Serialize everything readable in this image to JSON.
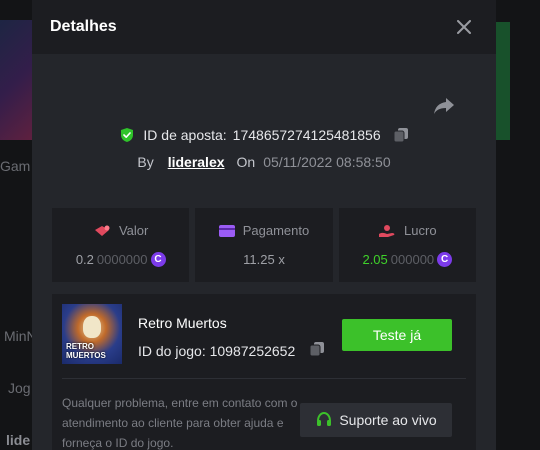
{
  "background": {
    "frag_gam": "Gam",
    "frag_min": "MinN",
    "frag_jog": "Jog",
    "frag_lide": "lide"
  },
  "modal": {
    "title": "Detalhes",
    "bet_id_label": "ID de aposta:",
    "bet_id_value": "1748657274125481856",
    "by_label": "By",
    "username": "lideralex",
    "on_label": "On",
    "datetime": "05/11/2022 08:58:50"
  },
  "stats": {
    "valor": {
      "label": "Valor",
      "value_main": "0.2",
      "value_dim": "0000000"
    },
    "pagamento": {
      "label": "Pagamento",
      "value": "11.25 x"
    },
    "lucro": {
      "label": "Lucro",
      "value_main": "2.05",
      "value_dim": "000000"
    },
    "coin_symbol": "C"
  },
  "game": {
    "name": "Retro Muertos",
    "id_label": "ID do jogo:",
    "id_value": "10987252652",
    "thumb_text_line1": "RETRO",
    "thumb_text_line2": "MUERTOS",
    "try_label": "Teste já"
  },
  "support": {
    "help_text": "Qualquer problema, entre em contato com o atendimento ao cliente para obter ajuda e forneça o ID do jogo.",
    "button_label": "Suporte ao vivo"
  },
  "colors": {
    "accent_green": "#3cc12a",
    "coin_purple": "#7c3bea",
    "modal_bg": "#24262b"
  }
}
